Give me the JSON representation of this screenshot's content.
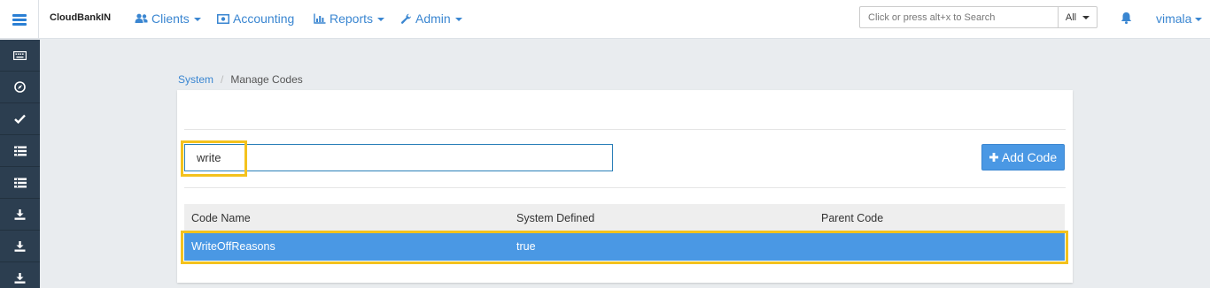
{
  "app": {
    "brand": "CloudBankIN"
  },
  "nav": {
    "clients": "Clients",
    "accounting": "Accounting",
    "reports": "Reports",
    "admin": "Admin"
  },
  "search": {
    "placeholder": "Click or press alt+x to Search",
    "scope": "All"
  },
  "user": {
    "name": "vimala"
  },
  "sidebar": {
    "icons": [
      "keyboard-icon",
      "compass-icon",
      "check-icon",
      "list-icon",
      "list-icon",
      "download-icon",
      "download-icon",
      "download-icon"
    ]
  },
  "breadcrumb": {
    "parent": "System",
    "separator": "/",
    "current": "Manage Codes"
  },
  "filter": {
    "value": "write"
  },
  "toolbar": {
    "add_code_label": "Add Code"
  },
  "table": {
    "headers": [
      "Code Name",
      "System Defined",
      "Parent Code"
    ],
    "rows": [
      {
        "code_name": "WriteOffReasons",
        "system_defined": "true",
        "parent_code": ""
      }
    ]
  },
  "colors": {
    "accent": "#4a98e4",
    "highlight": "#f4c21d",
    "sidebar": "#2c3e50"
  }
}
